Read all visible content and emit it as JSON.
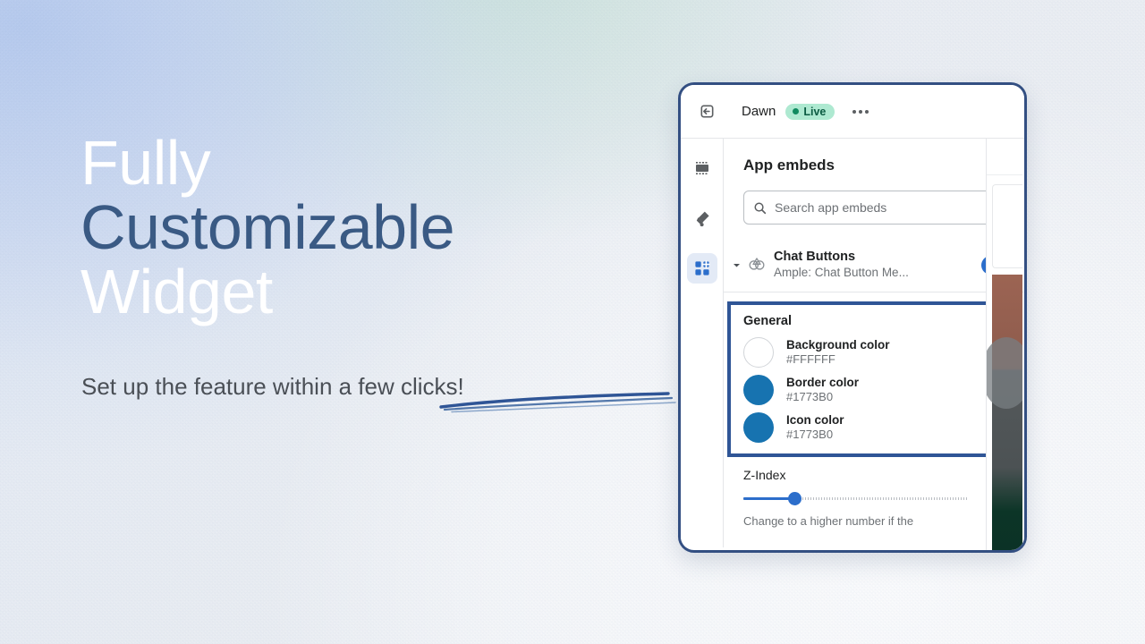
{
  "hero": {
    "line1": "Fully",
    "line2": "Customizable",
    "line3": "Widget",
    "subtitle": "Set up the feature within a few clicks!",
    "accent_color": "#3a5a84",
    "underline_color": "#2f5596"
  },
  "editor": {
    "topbar": {
      "exit_icon": "exit-icon",
      "store_name": "Dawn",
      "status_label": "Live",
      "status_color": "#aee9d1",
      "more_icon": "more-horizontal-icon"
    },
    "rail": [
      {
        "icon": "sections-icon",
        "active": false
      },
      {
        "icon": "paint-roller-icon",
        "active": false
      },
      {
        "icon": "app-blocks-icon",
        "active": true
      }
    ],
    "panel": {
      "heading": "App embeds",
      "search_placeholder": "Search app embeds",
      "search_value": "",
      "search_icon": "search-icon",
      "embed": {
        "caret_icon": "caret-down-icon",
        "app_icon": "ample-app-icon",
        "title": "Chat Buttons",
        "subtitle": "Ample: Chat Button Me...",
        "toggle_on": true,
        "toggle_color": "#2c6ecb"
      },
      "general": {
        "title": "General",
        "highlight_color": "#2f5596",
        "colors": [
          {
            "label": "Background color",
            "value": "#FFFFFF",
            "swatch": "#FFFFFF"
          },
          {
            "label": "Border color",
            "value": "#1773B0",
            "swatch": "#1773B0"
          },
          {
            "label": "Icon color",
            "value": "#1773B0",
            "swatch": "#1773B0"
          }
        ]
      },
      "zindex": {
        "label": "Z-Index",
        "value": "20",
        "hint": "Change to a higher number if the"
      }
    }
  }
}
